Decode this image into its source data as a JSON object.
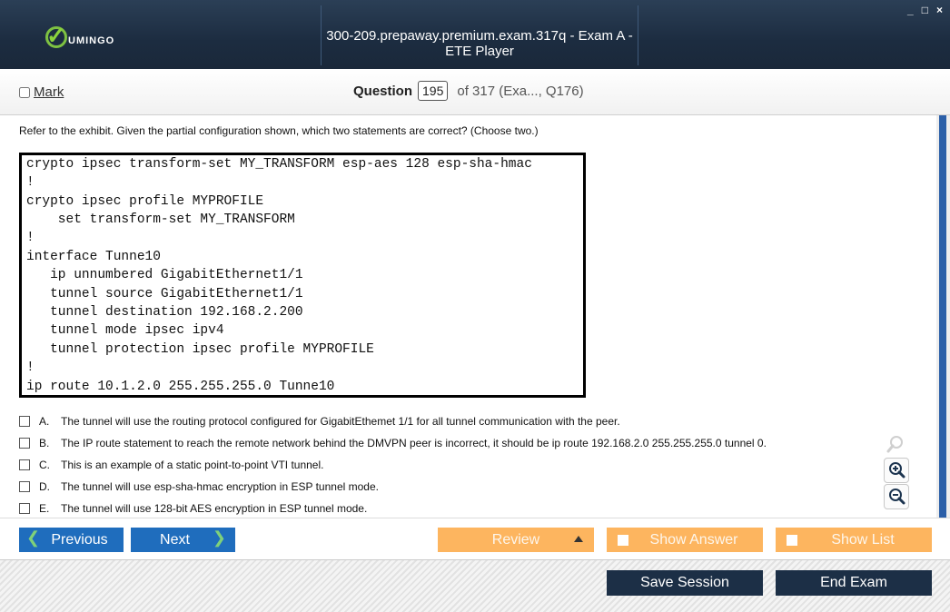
{
  "window": {
    "title": "300-209.prepaway.premium.exam.317q - Exam A - ETE Player",
    "logo_text": "UMINGO",
    "controls": [
      "_",
      "□",
      "×"
    ]
  },
  "header": {
    "mark_label": "Mark",
    "question_label": "Question",
    "question_number": "195",
    "of_text": "of 317 (Exa..., Q176)"
  },
  "question": {
    "prompt": "Refer to the exhibit. Given the partial configuration shown, which two statements are correct? (Choose two.)",
    "exhibit_lines": [
      "crypto ipsec transform-set MY_TRANSFORM esp-aes 128 esp-sha-hmac",
      "!",
      "crypto ipsec profile MYPROFILE",
      "    set transform-set MY_TRANSFORM",
      "!",
      "interface Tunne10",
      "   ip unnumbered GigabitEthernet1/1",
      "   tunnel source GigabitEthernet1/1",
      "   tunnel destination 192.168.2.200",
      "   tunnel mode ipsec ipv4",
      "   tunnel protection ipsec profile MYPROFILE",
      "!",
      "ip route 10.1.2.0 255.255.255.0 Tunne10"
    ],
    "answers": [
      {
        "letter": "A.",
        "text": "The tunnel will use the routing protocol configured for GigabitEthemet 1/1 for all tunnel communication with the peer."
      },
      {
        "letter": "B.",
        "text": "The IP route statement to reach the remote network behind the DMVPN peer is incorrect, it should be ip route 192.168.2.0 255.255.255.0 tunnel 0."
      },
      {
        "letter": "C.",
        "text": "This is an example of a static point-to-point VTI tunnel."
      },
      {
        "letter": "D.",
        "text": "The tunnel will use esp-sha-hmac encryption in ESP tunnel mode."
      },
      {
        "letter": "E.",
        "text": "The tunnel will use 128-bit AES encryption in ESP tunnel mode."
      }
    ]
  },
  "toolbar": {
    "previous": "Previous",
    "next": "Next",
    "review": "Review",
    "show_answer": "Show Answer",
    "show_list": "Show List"
  },
  "footer": {
    "save_session": "Save Session",
    "end_exam": "End Exam"
  },
  "colors": {
    "titlebar": "#1c2c40",
    "blue_button": "#1f6dbd",
    "orange_button": "#fdb55f",
    "dark_button": "#1c2f46",
    "scroll_thumb": "#2b5fa8"
  }
}
